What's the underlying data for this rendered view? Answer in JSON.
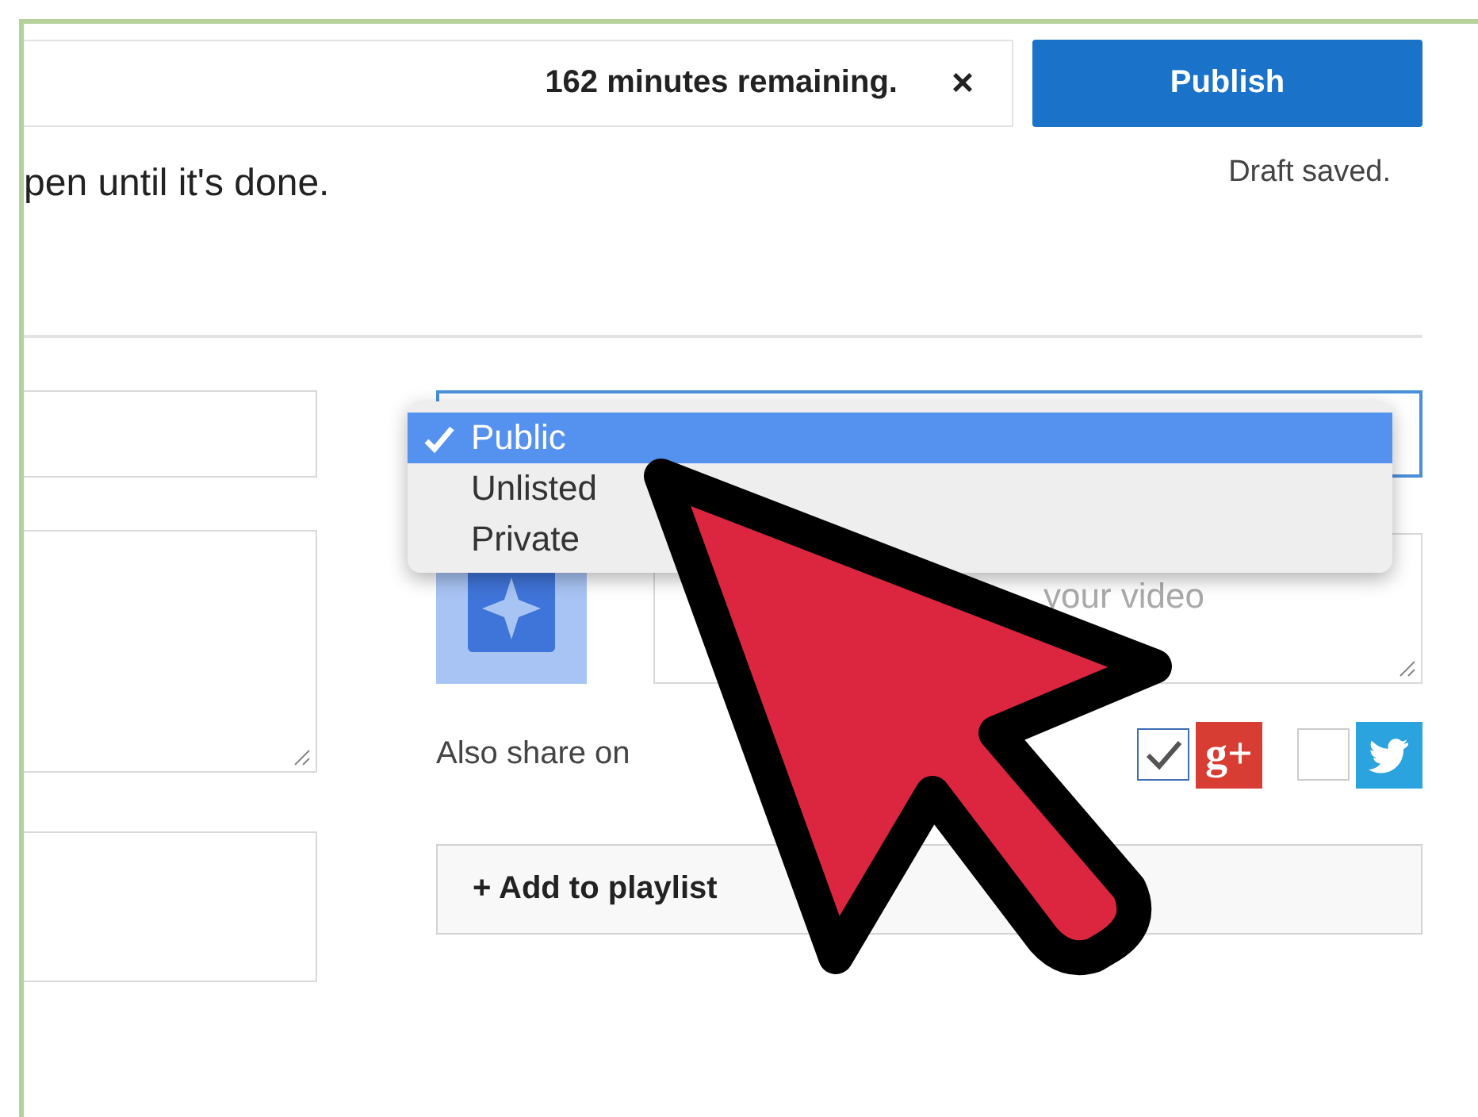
{
  "upload": {
    "status": "162 minutes remaining.",
    "close": "×"
  },
  "publish": {
    "label": "Publish",
    "note": "Draft saved."
  },
  "message": "pen until it's done.",
  "privacy": {
    "options": [
      {
        "label": "Public",
        "selected": true
      },
      {
        "label": "Unlisted",
        "selected": false
      },
      {
        "label": "Private",
        "selected": false
      }
    ]
  },
  "description": {
    "visible_text": "your video"
  },
  "share": {
    "label": "Also share on",
    "networks": [
      {
        "kind": "google-plus",
        "logo": "g+",
        "checked": true
      },
      {
        "kind": "twitter",
        "checked": false
      }
    ]
  },
  "playlist_button": "+ Add to playlist"
}
